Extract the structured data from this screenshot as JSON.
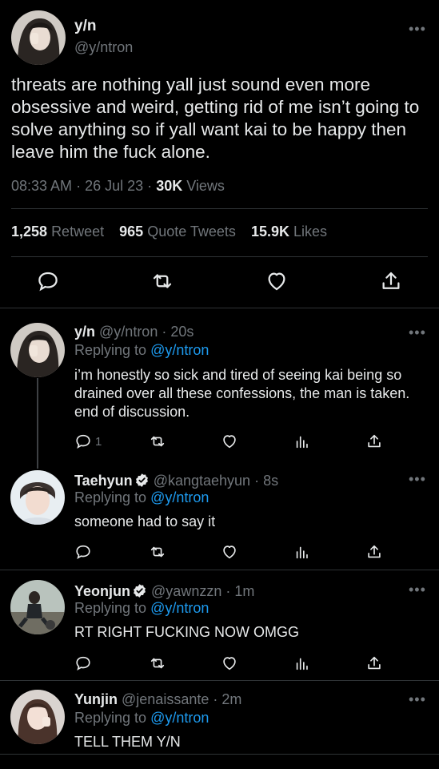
{
  "main_tweet": {
    "name": "y/n",
    "handle": "@y/ntron",
    "text": "threats are nothing yall just sound even more obsessive and weird, getting rid of me isn’t going to solve anything so if yall want kai to be happy then leave him the fuck alone.",
    "time": "08:33 AM",
    "date": "26 Jul 23",
    "views_count": "30K",
    "views_label": "Views",
    "retweets_count": "1,258",
    "retweets_label": "Retweet",
    "quotes_count": "965",
    "quotes_label": "Quote Tweets",
    "likes_count": "15.9K",
    "likes_label": "Likes",
    "separator": "·",
    "actions": [
      "comment-icon",
      "retweet-icon",
      "heart-icon",
      "share-icon"
    ]
  },
  "replying_prefix": "Replying to",
  "replies": [
    {
      "name": "y/n",
      "handle": "@y/ntron",
      "time": "20s",
      "replying_to": "@y/ntron",
      "text": "i’m honestly so sick and tired of seeing kai being so drained over all these confessions, the man is taken. end of discussion.",
      "reply_count": "1",
      "verified": false
    },
    {
      "name": "Taehyun",
      "handle": "@kangtaehyun",
      "time": "8s",
      "replying_to": "@y/ntron",
      "text": "someone had to say it",
      "reply_count": "",
      "verified": true
    },
    {
      "name": "Yeonjun",
      "handle": "@yawnzzn",
      "time": "1m",
      "replying_to": "@y/ntron",
      "text": "RT RIGHT FUCKING NOW OMGG",
      "reply_count": "",
      "verified": true
    },
    {
      "name": "Yunjin",
      "handle": "@jenaissante",
      "time": "2m",
      "replying_to": "@y/ntron",
      "text": "TELL THEM Y/N",
      "reply_count": "",
      "verified": false
    }
  ],
  "colors": {
    "background": "#000000",
    "text": "#e7e9ea",
    "muted": "#71767b",
    "link": "#1d9bf0",
    "divider": "#2f3336"
  }
}
